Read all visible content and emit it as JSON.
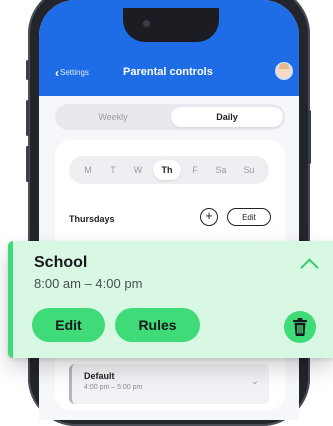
{
  "header": {
    "back_label": "Settings",
    "title": "Parental controls"
  },
  "view_toggle": {
    "options": [
      "Weekly",
      "Daily"
    ],
    "selected": "Daily"
  },
  "days": {
    "items": [
      "M",
      "T",
      "W",
      "Th",
      "F",
      "Sa",
      "Su"
    ],
    "selected": "Th"
  },
  "day_section": {
    "title": "Thursdays",
    "add_icon": "plus-circle-icon",
    "edit_label": "Edit"
  },
  "selected_schedule": {
    "title": "School",
    "time": "8:00 am – 4:00 pm",
    "edit_label": "Edit",
    "rules_label": "Rules",
    "delete_icon": "trash-icon",
    "collapse_icon": "chevron-up-icon",
    "accent_color": "#3fdb78",
    "background_color": "#d8f8e4"
  },
  "schedules": [
    {
      "title": "Default",
      "time": "4:00 pm – 5:00 pm"
    }
  ],
  "colors": {
    "header": "#1e6de6"
  }
}
